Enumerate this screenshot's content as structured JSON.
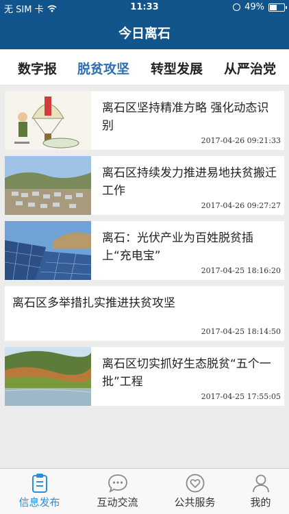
{
  "status_bar": {
    "carrier": "无 SIM 卡",
    "time": "11:33",
    "battery": "49%",
    "battery_level": 0.49
  },
  "header": {
    "title": "今日离石"
  },
  "tabs": [
    {
      "label": "数字报",
      "active": false
    },
    {
      "label": "脱贫攻坚",
      "active": true
    },
    {
      "label": "转型发展",
      "active": false
    },
    {
      "label": "从严治党",
      "active": false
    }
  ],
  "articles": [
    {
      "title": "离石区坚持精准方略 强化动态识别",
      "time": "2017-04-26 09:21:33",
      "has_image": true,
      "image": "cartoon-parachute",
      "image_text": [
        "精准扶贫",
        "贫困人群"
      ]
    },
    {
      "title": "离石区持续发力推进易地扶贫搬迁工作",
      "time": "2017-04-26 09:27:27",
      "has_image": true,
      "image": "village-landscape"
    },
    {
      "title": "离石：光伏产业为百姓脱贫插上“充电宝”",
      "time": "2017-04-25 18:16:20",
      "has_image": true,
      "image": "solar-panels"
    },
    {
      "title": "离石区多举措扎实推进扶贫攻坚",
      "time": "2017-04-25 18:14:50",
      "has_image": false
    },
    {
      "title": "离石区切实抓好生态脱贫“五个一批”工程",
      "time": "2017-04-25 17:55:05",
      "has_image": true,
      "image": "forest-lake"
    }
  ],
  "tab_bar": [
    {
      "label": "信息发布",
      "icon": "clipboard-icon",
      "active": true
    },
    {
      "label": "互动交流",
      "icon": "chat-bubble-icon",
      "active": false
    },
    {
      "label": "公共服务",
      "icon": "heart-badge-icon",
      "active": false
    },
    {
      "label": "我的",
      "icon": "user-icon",
      "active": false
    }
  ],
  "colors": {
    "primary": "#12558c",
    "tab_active": "#2a6fb0",
    "tabbar_active": "#2a8fd6",
    "background": "#ececec"
  }
}
